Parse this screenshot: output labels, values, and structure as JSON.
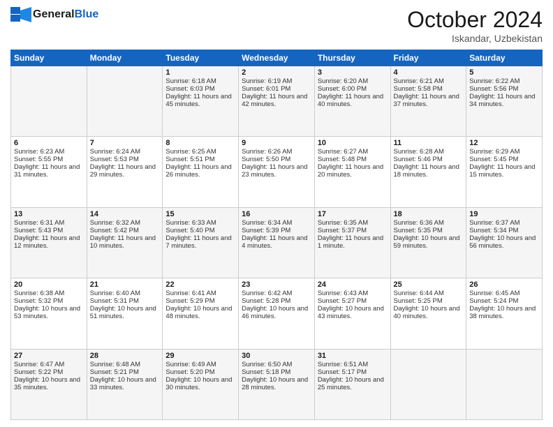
{
  "header": {
    "logo_general": "General",
    "logo_blue": "Blue",
    "month": "October 2024",
    "location": "Iskandar, Uzbekistan"
  },
  "weekdays": [
    "Sunday",
    "Monday",
    "Tuesday",
    "Wednesday",
    "Thursday",
    "Friday",
    "Saturday"
  ],
  "rows": [
    [
      {
        "day": "",
        "sunrise": "",
        "sunset": "",
        "daylight": ""
      },
      {
        "day": "",
        "sunrise": "",
        "sunset": "",
        "daylight": ""
      },
      {
        "day": "1",
        "sunrise": "Sunrise: 6:18 AM",
        "sunset": "Sunset: 6:03 PM",
        "daylight": "Daylight: 11 hours and 45 minutes."
      },
      {
        "day": "2",
        "sunrise": "Sunrise: 6:19 AM",
        "sunset": "Sunset: 6:01 PM",
        "daylight": "Daylight: 11 hours and 42 minutes."
      },
      {
        "day": "3",
        "sunrise": "Sunrise: 6:20 AM",
        "sunset": "Sunset: 6:00 PM",
        "daylight": "Daylight: 11 hours and 40 minutes."
      },
      {
        "day": "4",
        "sunrise": "Sunrise: 6:21 AM",
        "sunset": "Sunset: 5:58 PM",
        "daylight": "Daylight: 11 hours and 37 minutes."
      },
      {
        "day": "5",
        "sunrise": "Sunrise: 6:22 AM",
        "sunset": "Sunset: 5:56 PM",
        "daylight": "Daylight: 11 hours and 34 minutes."
      }
    ],
    [
      {
        "day": "6",
        "sunrise": "Sunrise: 6:23 AM",
        "sunset": "Sunset: 5:55 PM",
        "daylight": "Daylight: 11 hours and 31 minutes."
      },
      {
        "day": "7",
        "sunrise": "Sunrise: 6:24 AM",
        "sunset": "Sunset: 5:53 PM",
        "daylight": "Daylight: 11 hours and 29 minutes."
      },
      {
        "day": "8",
        "sunrise": "Sunrise: 6:25 AM",
        "sunset": "Sunset: 5:51 PM",
        "daylight": "Daylight: 11 hours and 26 minutes."
      },
      {
        "day": "9",
        "sunrise": "Sunrise: 6:26 AM",
        "sunset": "Sunset: 5:50 PM",
        "daylight": "Daylight: 11 hours and 23 minutes."
      },
      {
        "day": "10",
        "sunrise": "Sunrise: 6:27 AM",
        "sunset": "Sunset: 5:48 PM",
        "daylight": "Daylight: 11 hours and 20 minutes."
      },
      {
        "day": "11",
        "sunrise": "Sunrise: 6:28 AM",
        "sunset": "Sunset: 5:46 PM",
        "daylight": "Daylight: 11 hours and 18 minutes."
      },
      {
        "day": "12",
        "sunrise": "Sunrise: 6:29 AM",
        "sunset": "Sunset: 5:45 PM",
        "daylight": "Daylight: 11 hours and 15 minutes."
      }
    ],
    [
      {
        "day": "13",
        "sunrise": "Sunrise: 6:31 AM",
        "sunset": "Sunset: 5:43 PM",
        "daylight": "Daylight: 11 hours and 12 minutes."
      },
      {
        "day": "14",
        "sunrise": "Sunrise: 6:32 AM",
        "sunset": "Sunset: 5:42 PM",
        "daylight": "Daylight: 11 hours and 10 minutes."
      },
      {
        "day": "15",
        "sunrise": "Sunrise: 6:33 AM",
        "sunset": "Sunset: 5:40 PM",
        "daylight": "Daylight: 11 hours and 7 minutes."
      },
      {
        "day": "16",
        "sunrise": "Sunrise: 6:34 AM",
        "sunset": "Sunset: 5:39 PM",
        "daylight": "Daylight: 11 hours and 4 minutes."
      },
      {
        "day": "17",
        "sunrise": "Sunrise: 6:35 AM",
        "sunset": "Sunset: 5:37 PM",
        "daylight": "Daylight: 11 hours and 1 minute."
      },
      {
        "day": "18",
        "sunrise": "Sunrise: 6:36 AM",
        "sunset": "Sunset: 5:35 PM",
        "daylight": "Daylight: 10 hours and 59 minutes."
      },
      {
        "day": "19",
        "sunrise": "Sunrise: 6:37 AM",
        "sunset": "Sunset: 5:34 PM",
        "daylight": "Daylight: 10 hours and 56 minutes."
      }
    ],
    [
      {
        "day": "20",
        "sunrise": "Sunrise: 6:38 AM",
        "sunset": "Sunset: 5:32 PM",
        "daylight": "Daylight: 10 hours and 53 minutes."
      },
      {
        "day": "21",
        "sunrise": "Sunrise: 6:40 AM",
        "sunset": "Sunset: 5:31 PM",
        "daylight": "Daylight: 10 hours and 51 minutes."
      },
      {
        "day": "22",
        "sunrise": "Sunrise: 6:41 AM",
        "sunset": "Sunset: 5:29 PM",
        "daylight": "Daylight: 10 hours and 48 minutes."
      },
      {
        "day": "23",
        "sunrise": "Sunrise: 6:42 AM",
        "sunset": "Sunset: 5:28 PM",
        "daylight": "Daylight: 10 hours and 46 minutes."
      },
      {
        "day": "24",
        "sunrise": "Sunrise: 6:43 AM",
        "sunset": "Sunset: 5:27 PM",
        "daylight": "Daylight: 10 hours and 43 minutes."
      },
      {
        "day": "25",
        "sunrise": "Sunrise: 6:44 AM",
        "sunset": "Sunset: 5:25 PM",
        "daylight": "Daylight: 10 hours and 40 minutes."
      },
      {
        "day": "26",
        "sunrise": "Sunrise: 6:45 AM",
        "sunset": "Sunset: 5:24 PM",
        "daylight": "Daylight: 10 hours and 38 minutes."
      }
    ],
    [
      {
        "day": "27",
        "sunrise": "Sunrise: 6:47 AM",
        "sunset": "Sunset: 5:22 PM",
        "daylight": "Daylight: 10 hours and 35 minutes."
      },
      {
        "day": "28",
        "sunrise": "Sunrise: 6:48 AM",
        "sunset": "Sunset: 5:21 PM",
        "daylight": "Daylight: 10 hours and 33 minutes."
      },
      {
        "day": "29",
        "sunrise": "Sunrise: 6:49 AM",
        "sunset": "Sunset: 5:20 PM",
        "daylight": "Daylight: 10 hours and 30 minutes."
      },
      {
        "day": "30",
        "sunrise": "Sunrise: 6:50 AM",
        "sunset": "Sunset: 5:18 PM",
        "daylight": "Daylight: 10 hours and 28 minutes."
      },
      {
        "day": "31",
        "sunrise": "Sunrise: 6:51 AM",
        "sunset": "Sunset: 5:17 PM",
        "daylight": "Daylight: 10 hours and 25 minutes."
      },
      {
        "day": "",
        "sunrise": "",
        "sunset": "",
        "daylight": ""
      },
      {
        "day": "",
        "sunrise": "",
        "sunset": "",
        "daylight": ""
      }
    ]
  ]
}
